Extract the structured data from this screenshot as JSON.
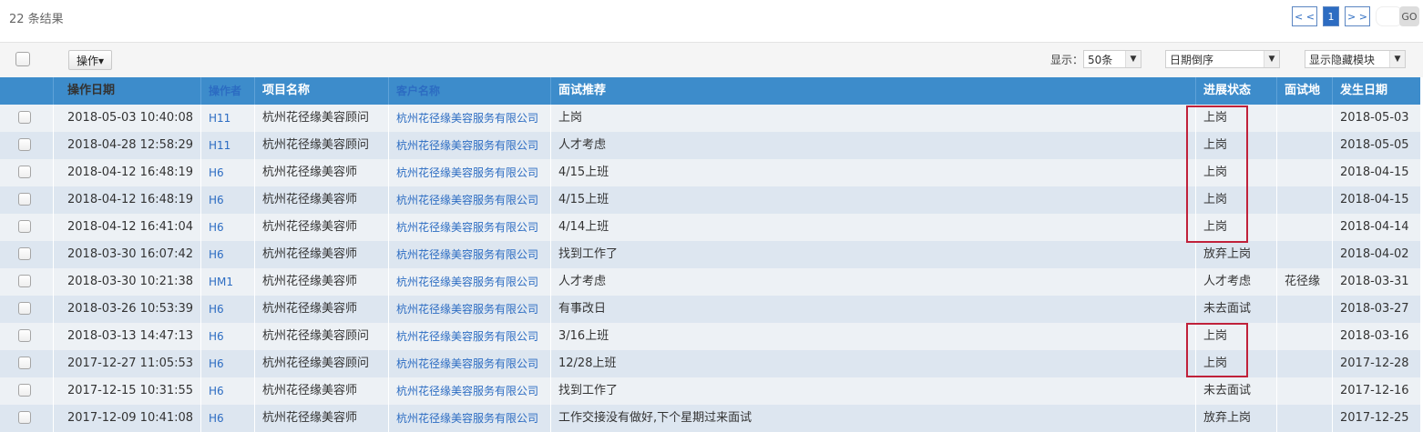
{
  "results": {
    "count_label": "22 条结果"
  },
  "pager": {
    "prev": "< <",
    "current": "1",
    "next": "> >",
    "go": "GO"
  },
  "toolbar": {
    "operation_label": "操作▾",
    "show_label": "显示：",
    "page_size": "50条",
    "sort": "日期倒序",
    "hidden_modules": "显示隐藏模块",
    "dropdown_arrow": "▼"
  },
  "table": {
    "headers": [
      "",
      "操作日期",
      "操作者",
      "项目名称",
      "客户名称",
      "面试推荐",
      "进展状态",
      "面试地",
      "发生日期"
    ],
    "rows": [
      [
        "2018-05-03 10:40:08",
        "H11",
        "杭州花径缘美容顾问",
        "杭州花径缘美容服务有限公司",
        "上岗",
        "上岗",
        "",
        "2018-05-03"
      ],
      [
        "2018-04-28 12:58:29",
        "H11",
        "杭州花径缘美容顾问",
        "杭州花径缘美容服务有限公司",
        "人才考虑",
        "上岗",
        "",
        "2018-05-05"
      ],
      [
        "2018-04-12 16:48:19",
        "H6",
        "杭州花径缘美容师",
        "杭州花径缘美容服务有限公司",
        "4/15上班",
        "上岗",
        "",
        "2018-04-15"
      ],
      [
        "2018-04-12 16:48:19",
        "H6",
        "杭州花径缘美容师",
        "杭州花径缘美容服务有限公司",
        "4/15上班",
        "上岗",
        "",
        "2018-04-15"
      ],
      [
        "2018-04-12 16:41:04",
        "H6",
        "杭州花径缘美容师",
        "杭州花径缘美容服务有限公司",
        "4/14上班",
        "上岗",
        "",
        "2018-04-14"
      ],
      [
        "2018-03-30 16:07:42",
        "H6",
        "杭州花径缘美容师",
        "杭州花径缘美容服务有限公司",
        "找到工作了",
        "放弃上岗",
        "",
        "2018-04-02"
      ],
      [
        "2018-03-30 10:21:38",
        "HM1",
        "杭州花径缘美容师",
        "杭州花径缘美容服务有限公司",
        "人才考虑",
        "人才考虑",
        "花径缘",
        "2018-03-31"
      ],
      [
        "2018-03-26 10:53:39",
        "H6",
        "杭州花径缘美容师",
        "杭州花径缘美容服务有限公司",
        "有事改日",
        "未去面试",
        "",
        "2018-03-27"
      ],
      [
        "2018-03-13 14:47:13",
        "H6",
        "杭州花径缘美容顾问",
        "杭州花径缘美容服务有限公司",
        "3/16上班",
        "上岗",
        "",
        "2018-03-16"
      ],
      [
        "2017-12-27 11:05:53",
        "H6",
        "杭州花径缘美容顾问",
        "杭州花径缘美容服务有限公司",
        "12/28上班",
        "上岗",
        "",
        "2017-12-28"
      ],
      [
        "2017-12-15 10:31:55",
        "H6",
        "杭州花径缘美容师",
        "杭州花径缘美容服务有限公司",
        "找到工作了",
        "未去面试",
        "",
        "2017-12-16"
      ],
      [
        "2017-12-09 10:41:08",
        "H6",
        "杭州花径缘美容师",
        "杭州花径缘美容服务有限公司",
        "工作交接没有做好,下个星期过来面试",
        "放弃上岗",
        "",
        "2017-12-25"
      ]
    ]
  },
  "colors": {
    "header_bg": "#3d8ccb",
    "link": "#2c6cc2",
    "highlight": "#c0213a"
  }
}
